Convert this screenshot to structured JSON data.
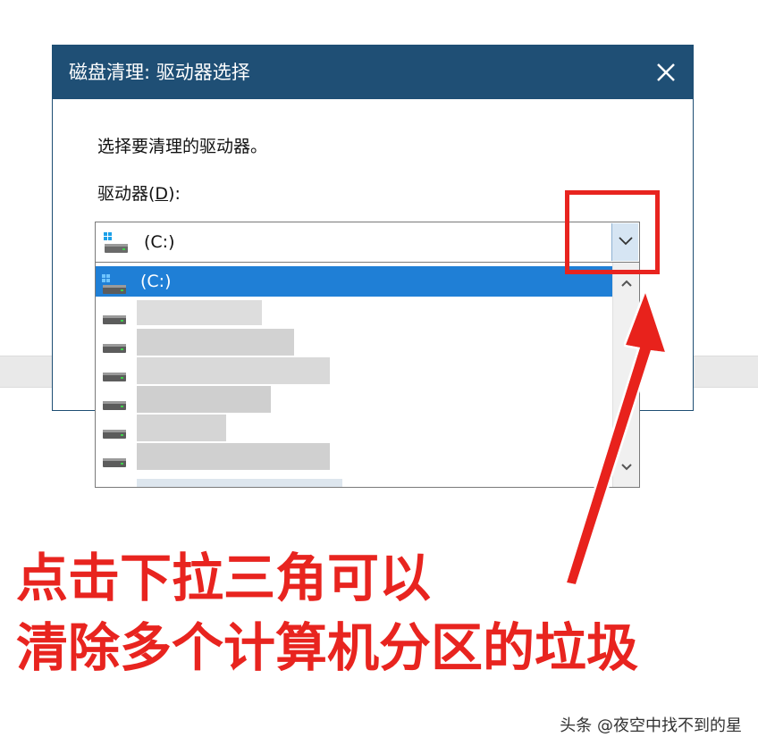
{
  "dialog": {
    "title": "磁盘清理: 驱动器选择",
    "instruction": "选择要清理的驱动器。",
    "drive_label_prefix": "驱动器(",
    "drive_label_mnemonic": "D",
    "drive_label_suffix": "):"
  },
  "combo": {
    "selected_value": "(C:)"
  },
  "dropdown": {
    "options": [
      {
        "label": "(C:)",
        "selected": true
      }
    ]
  },
  "annotation": {
    "line1": "点击下拉三角可以",
    "line2": "清除多个计算机分区的垃圾",
    "color": "#e8241f"
  },
  "watermark": "头条 @夜空中找不到的星",
  "colors": {
    "titlebar": "#1f4f75",
    "selection": "#1f7fd6"
  }
}
